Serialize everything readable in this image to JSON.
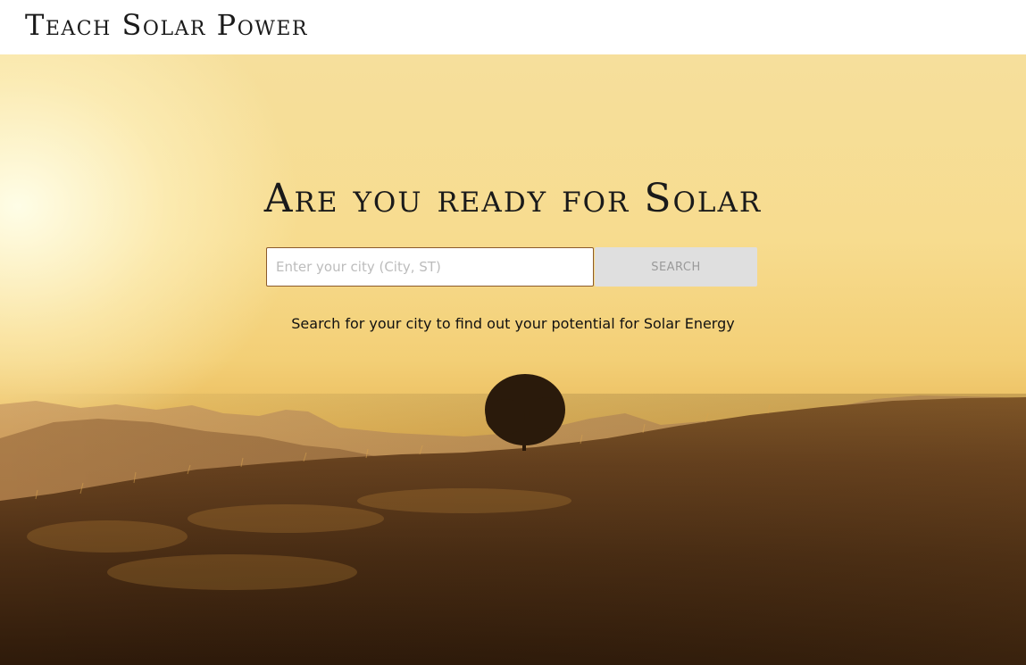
{
  "header": {
    "brand": "Teach Solar Power"
  },
  "hero": {
    "headline": "Are you ready for Solar",
    "search": {
      "placeholder": "Enter your city (City, ST)",
      "value": "",
      "button_label": "SEARCH"
    },
    "subtext": "Search for your city to find out your potential for Solar Energy",
    "background_image": "sunset-hill-lone-tree"
  },
  "colors": {
    "sky_light": "#f7e3a6",
    "sky_warm": "#e9b95a",
    "hill_dark": "#3d2410",
    "button_bg": "#dfdfdf",
    "button_text": "#9a9a9a",
    "input_border": "#8b5a2b"
  }
}
